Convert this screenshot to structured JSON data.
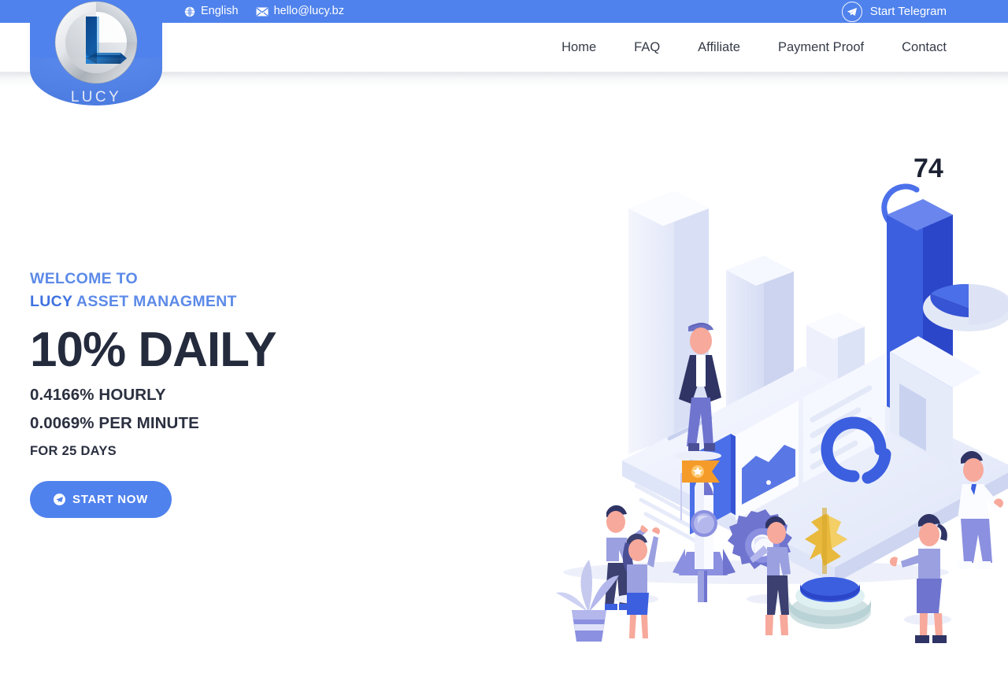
{
  "colors": {
    "brand_blue": "#4f82ec",
    "cta_blue": "#5082ed",
    "welcome_blue": "#5c8ae8",
    "headline_navy": "#242b3d",
    "nav_text": "#353b48",
    "illus_accent": "#3c5fe0",
    "illus_light": "#e7ebfa",
    "illus_mid": "#8b90e0",
    "illus_gold": "#e8b93c",
    "illus_orange": "#f59b2a"
  },
  "topbar": {
    "language": {
      "label": "English",
      "icon": "globe-icon"
    },
    "email": {
      "label": "hello@lucy.bz",
      "icon": "envelope-icon"
    },
    "telegram": {
      "label": "Start Telegram",
      "icon": "telegram-icon"
    }
  },
  "logo": {
    "wordmark": "LUCY",
    "emblem_icon": "lucy-l-emblem-icon"
  },
  "nav": {
    "items": [
      {
        "label": "Home"
      },
      {
        "label": "FAQ"
      },
      {
        "label": "Affiliate"
      },
      {
        "label": "Payment Proof"
      },
      {
        "label": "Contact"
      }
    ]
  },
  "hero": {
    "welcome_line1": "WELCOME TO",
    "welcome_brand": "LUCY",
    "welcome_rest": " ASSET MANAGMENT",
    "headline": "10% DAILY",
    "rate_hourly": "0.4166% HOURLY",
    "rate_minute": "0.0069% PER MINUTE",
    "duration": "FOR 25 DAYS",
    "cta_label": "START NOW",
    "cta_icon": "telegram-send-icon"
  },
  "illustration": {
    "name": "isometric-finance-dashboard-illustration",
    "gauge_value": "74",
    "elements": [
      "bar-chart-columns",
      "gauge-badge-74",
      "donut-chart",
      "isometric-pie-3d",
      "rocket-with-flag",
      "gear",
      "dollar-trophy",
      "potted-plant",
      "person-standing-top",
      "person-pointing-left",
      "person-cheering",
      "person-with-gear",
      "person-right-suit",
      "person-right-ponytail"
    ]
  }
}
